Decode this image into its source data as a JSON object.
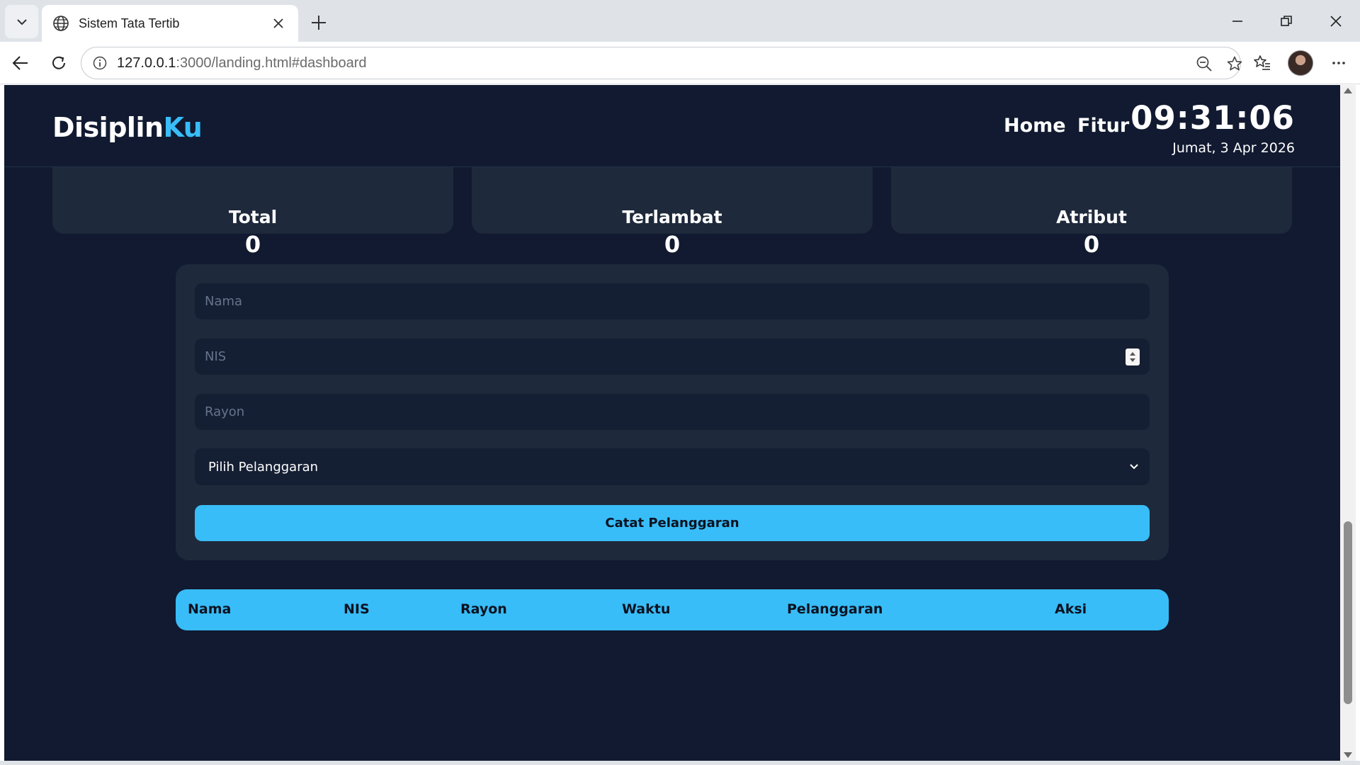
{
  "browser": {
    "tab_title": "Sistem Tata Tertib",
    "url_host": "127.0.0.1",
    "url_rest": ":3000/landing.html#dashboard"
  },
  "header": {
    "logo_main": "Disiplin",
    "logo_accent": "Ku",
    "nav": [
      {
        "label": "Home"
      },
      {
        "label": "Fitur"
      }
    ],
    "clock": "09:31:06",
    "date": "Jumat, 3 Apr 2026"
  },
  "stats": [
    {
      "label": "Total",
      "value": "0"
    },
    {
      "label": "Terlambat",
      "value": "0"
    },
    {
      "label": "Atribut",
      "value": "0"
    }
  ],
  "form": {
    "nama_placeholder": "Nama",
    "nis_placeholder": "NIS",
    "rayon_placeholder": "Rayon",
    "select_value": "Pilih Pelanggaran",
    "submit_label": "Catat Pelanggaran"
  },
  "table": {
    "columns": [
      "Nama",
      "NIS",
      "Rayon",
      "Waktu",
      "Pelanggaran",
      "Aksi"
    ]
  },
  "colors": {
    "accent": "#38bdf8",
    "page_bg": "#111a30",
    "card_bg": "#1e293b"
  }
}
